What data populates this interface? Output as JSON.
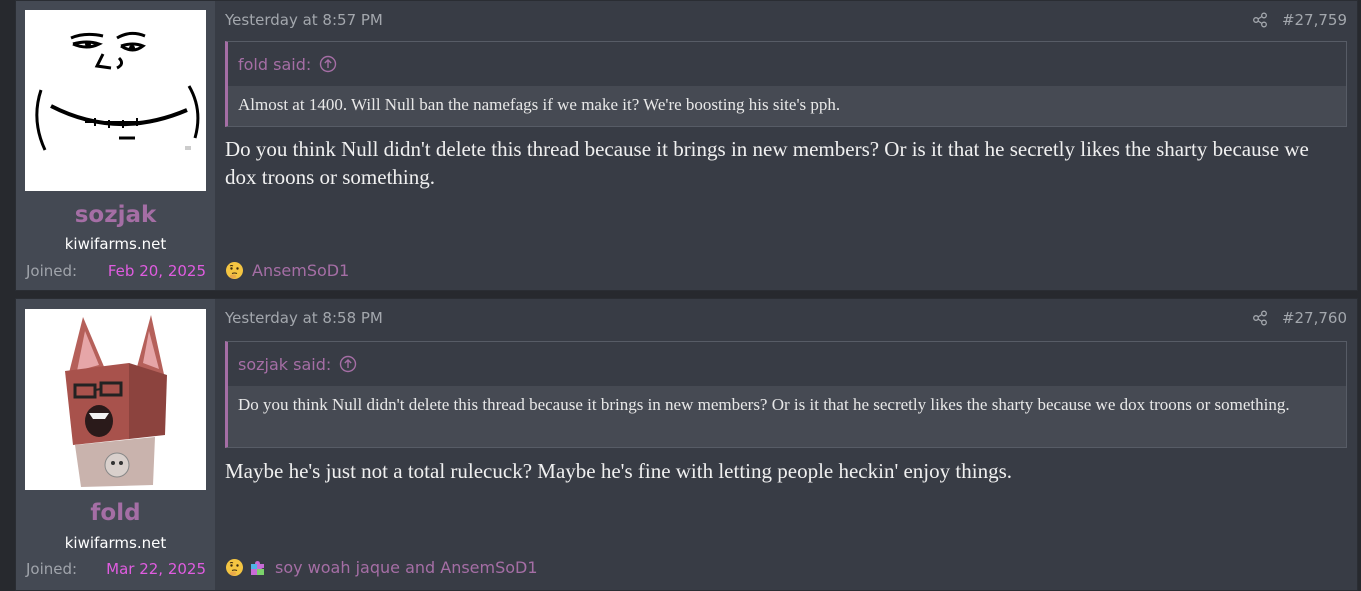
{
  "posts": [
    {
      "username": "sozjak",
      "user_title": "kiwifarms.net",
      "joined_label": "Joined:",
      "joined_date": "Feb 20, 2025",
      "timestamp": "Yesterday at 8:57 PM",
      "post_number": "#27,759",
      "quote_author": "fold said:",
      "quote_text": "Almost at 1400. Will Null ban the namefags if we make it? We're boosting his site's pph.",
      "message": "Do you think Null didn't delete this thread because it brings in new members? Or is it that he secretly likes the sharty because we dox troons or something.",
      "reactions_text": "AnsemSoD1",
      "reaction_icons": [
        "thinking-face-icon"
      ]
    },
    {
      "username": "fold",
      "user_title": "kiwifarms.net",
      "joined_label": "Joined:",
      "joined_date": "Mar 22, 2025",
      "timestamp": "Yesterday at 8:58 PM",
      "post_number": "#27,760",
      "quote_author": "sozjak said:",
      "quote_text": "Do you think Null didn't delete this thread because it brings in new members? Or is it that he secretly likes the sharty because we dox troons or something.",
      "message": "Maybe he's just not a total rulecuck? Maybe he's fine with letting people heckin' enjoy things.",
      "reactions_text": "soy woah jaque and AnsemSoD1",
      "reaction_icons": [
        "thinking-face-icon",
        "puzzle-piece-icon"
      ]
    }
  ],
  "colors": {
    "accent": "#a56ea5",
    "joined_date": "#e05ce0",
    "page_bg": "#27292e",
    "post_bg": "#383c45",
    "user_cell_bg": "#444953"
  }
}
